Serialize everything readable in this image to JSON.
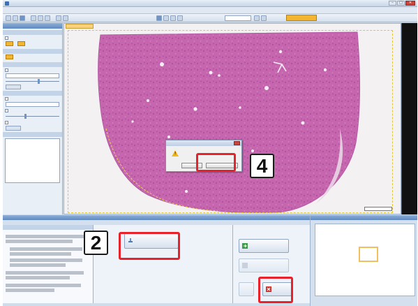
{
  "window": {
    "title": "",
    "min_label": "–",
    "max_label": "□",
    "close_label": "✕"
  },
  "menu": {
    "items": [
      "",
      "",
      "",
      "",
      "",
      "",
      "",
      "",
      "",
      "",
      ""
    ]
  },
  "toolbar": {
    "zoom_value": "",
    "highlight_button_label": "",
    "right_labels": [
      "",
      ""
    ]
  },
  "left_panel": {
    "title": "",
    "sections": [
      "",
      "",
      "",
      "",
      ""
    ],
    "checkboxes": [
      "",
      "",
      "",
      "",
      ""
    ],
    "info_rows": [
      {
        "k": "",
        "v": ""
      },
      {
        "k": "",
        "v": ""
      },
      {
        "k": "",
        "v": ""
      },
      {
        "k": "",
        "v": ""
      },
      {
        "k": "",
        "v": ""
      },
      {
        "k": "",
        "v": ""
      },
      {
        "k": "",
        "v": ""
      },
      {
        "k": "",
        "v": ""
      },
      {
        "k": "",
        "v": ""
      },
      {
        "k": "",
        "v": ""
      }
    ]
  },
  "viewer": {
    "tab_label": "",
    "scale_label": ""
  },
  "dialog": {
    "title": "",
    "message": "",
    "ok_label": "",
    "cancel_label": ""
  },
  "bottom": {
    "bar_title": "",
    "tabs": [
      "",
      ""
    ],
    "instructions_heading": "",
    "action_button_label": "",
    "step_heading": "",
    "step_buttons": [
      "",
      "",
      "",
      ""
    ]
  },
  "navigator": {
    "title": "",
    "status": ""
  },
  "annotations": {
    "step_2": "2",
    "step_4": "4",
    "highlight_color": "#e8212b"
  }
}
